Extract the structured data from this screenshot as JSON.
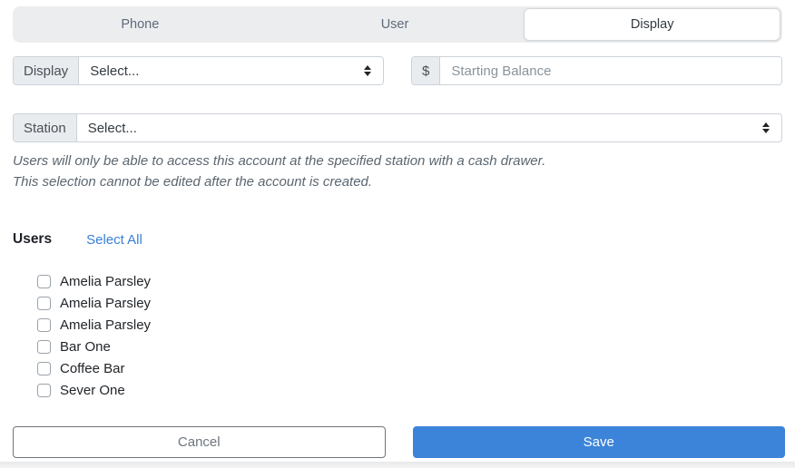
{
  "tabs": [
    {
      "label": "Phone",
      "active": false
    },
    {
      "label": "User",
      "active": false
    },
    {
      "label": "Display",
      "active": true
    }
  ],
  "form": {
    "display": {
      "label": "Display",
      "value": "Select..."
    },
    "starting_balance": {
      "prefix": "$",
      "placeholder": "Starting Balance",
      "value": ""
    },
    "station": {
      "label": "Station",
      "value": "Select..."
    },
    "station_help_line1": "Users will only be able to access this account at the specified station with a cash drawer.",
    "station_help_line2": "This selection cannot be edited after the account is created."
  },
  "users": {
    "heading": "Users",
    "select_all_label": "Select All",
    "items": [
      {
        "name": "Amelia Parsley",
        "checked": false
      },
      {
        "name": "Amelia Parsley",
        "checked": false
      },
      {
        "name": "Amelia Parsley",
        "checked": false
      },
      {
        "name": "Bar One",
        "checked": false
      },
      {
        "name": "Coffee Bar",
        "checked": false
      },
      {
        "name": "Sever One",
        "checked": false
      }
    ]
  },
  "actions": {
    "cancel_label": "Cancel",
    "save_label": "Save"
  },
  "colors": {
    "accent": "#3c84d9",
    "link": "#3a80d6",
    "tab_bar_bg": "#ebedef",
    "label_bg": "#e9ecef",
    "border": "#ccd2d8",
    "help_text": "#5b6670"
  }
}
